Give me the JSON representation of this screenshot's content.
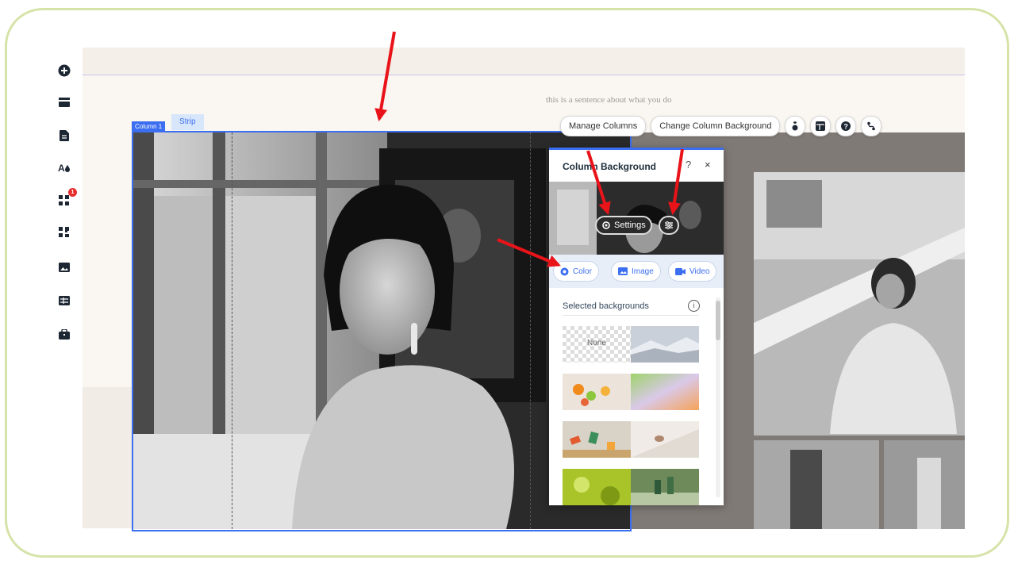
{
  "canvas": {
    "tagline": "this is a sentence about what you do",
    "column_tag": "Column 1",
    "strip_tag": "Strip"
  },
  "sidebar": {
    "items": [
      {
        "icon": "plus-circle-icon"
      },
      {
        "icon": "strip-icon"
      },
      {
        "icon": "page-icon"
      },
      {
        "icon": "theme-icon"
      },
      {
        "icon": "apps-icon",
        "badge": "1"
      },
      {
        "icon": "puzzle-icon"
      },
      {
        "icon": "media-icon"
      },
      {
        "icon": "table-icon"
      },
      {
        "icon": "briefcase-icon"
      }
    ]
  },
  "toolbar": {
    "manage_columns": "Manage Columns",
    "change_background": "Change Column Background",
    "icons": [
      "animation-icon",
      "layout-icon",
      "help-icon",
      "connect-icon"
    ]
  },
  "panel": {
    "title": "Column Background",
    "help": "?",
    "close": "×",
    "settings_label": "Settings",
    "adjust_icon": "adjust-icon",
    "choices": [
      "Color",
      "Image",
      "Video"
    ],
    "selected_label": "Selected backgrounds",
    "info": "i",
    "thumbs": [
      {
        "label": "None"
      },
      {
        "label": ""
      },
      {
        "label": ""
      },
      {
        "label": ""
      },
      {
        "label": ""
      },
      {
        "label": ""
      },
      {
        "label": ""
      },
      {
        "label": ""
      }
    ]
  },
  "colors": {
    "accent_blue": "#3b6ef0",
    "frame_border": "#d6e3a8",
    "annotation_arrow": "#e8141a"
  }
}
